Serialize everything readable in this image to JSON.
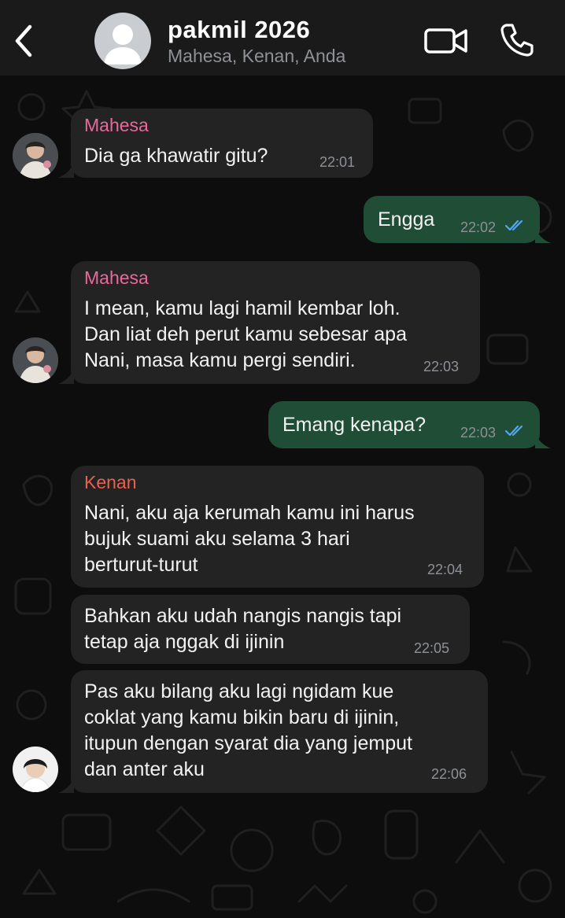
{
  "header": {
    "title": "pakmil 2026",
    "subtitle": "Mahesa, Kenan, Anda",
    "back_icon": "chevron-left-icon",
    "video_icon": "video-camera-icon",
    "call_icon": "phone-icon"
  },
  "messages": [
    {
      "direction": "in",
      "sender": "Mahesa",
      "text": "Dia ga khawatir gitu?",
      "time": "22:01"
    },
    {
      "direction": "out",
      "text": "Engga",
      "time": "22:02",
      "status": "read"
    },
    {
      "direction": "in",
      "sender": "Mahesa",
      "text": "I mean, kamu lagi hamil kembar loh.\nDan liat deh perut kamu sebesar apa\nNani, masa kamu pergi sendiri.",
      "time": "22:03"
    },
    {
      "direction": "out",
      "text": "Emang kenapa?",
      "time": "22:03",
      "status": "read"
    },
    {
      "direction": "in",
      "sender": "Kenan",
      "text": "Nani, aku aja kerumah kamu ini harus\nbujuk suami aku selama 3 hari\nberturut-turut",
      "time": "22:04"
    },
    {
      "direction": "in",
      "text": "Bahkan aku udah nangis nangis tapi\ntetap aja nggak di ijinin",
      "time": "22:05"
    },
    {
      "direction": "in",
      "text": "Pas aku bilang aku lagi ngidam kue\ncoklat yang kamu bikin baru di ijinin,\nitupun dengan syarat dia yang jemput\ndan anter aku",
      "time": "22:06"
    }
  ],
  "colors": {
    "header_bg": "#1a1a1a",
    "incoming_bubble": "#232323",
    "outgoing_bubble": "#1f4d36",
    "mahesa_name": "#e8699a",
    "kenan_name": "#e8614f",
    "read_ticks": "#53a6f4"
  }
}
